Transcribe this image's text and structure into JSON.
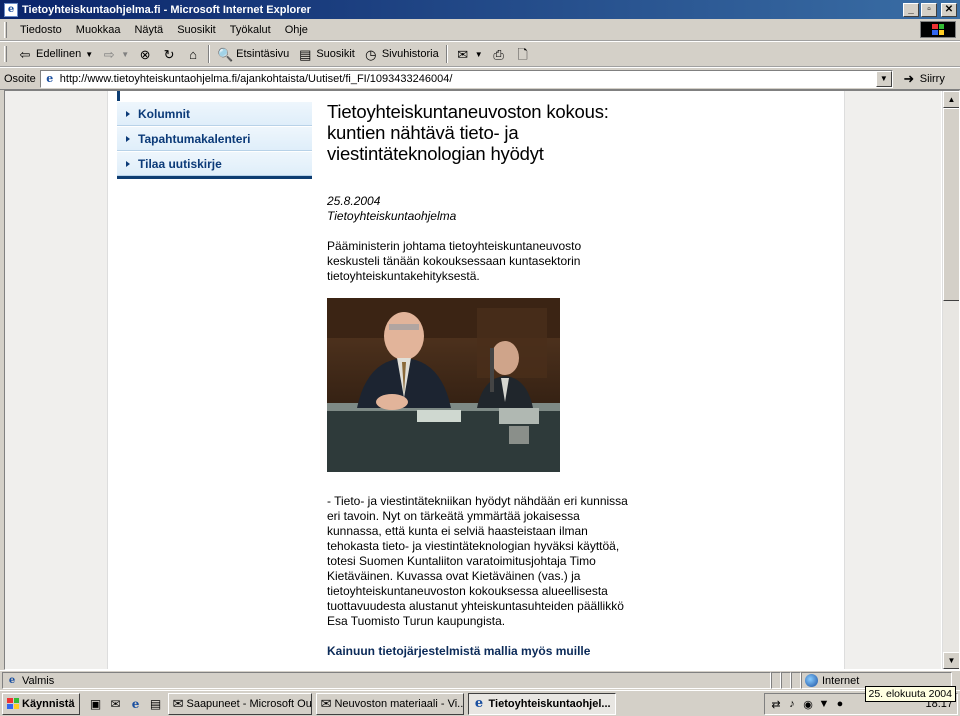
{
  "window": {
    "title": "Tietoyhteiskuntaohjelma.fi - Microsoft Internet Explorer",
    "controls": {
      "minimize": "_",
      "maximize": "▫",
      "close": "✕"
    }
  },
  "menu": {
    "items": [
      "Tiedosto",
      "Muokkaa",
      "Näytä",
      "Suosikit",
      "Työkalut",
      "Ohje"
    ]
  },
  "toolbar": {
    "back_label": "Edellinen",
    "search_label": "Etsintäsivu",
    "favorites_label": "Suosikit",
    "history_label": "Sivuhistoria"
  },
  "address": {
    "label": "Osoite",
    "url": "http://www.tietoyhteiskuntaohjelma.fi/ajankohtaista/Uutiset/fi_FI/1093433246004/",
    "go_label": "Siirry"
  },
  "sidebar_nav": {
    "items": [
      "Kolumnit",
      "Tapahtumakalenteri",
      "Tilaa uutiskirje"
    ]
  },
  "article": {
    "headline": "Tietoyhteiskuntaneuvoston kokous: kuntien nähtävä tieto- ja viestintäteknologian hyödyt",
    "date": "25.8.2004",
    "source": "Tietoyhteiskuntaohjelma",
    "lead": "Pääministerin johtama tietoyhteiskuntaneuvosto keskusteli tänään kokouksessaan kuntasektorin tietoyhteiskuntakehityksestä.",
    "caption": "- Tieto- ja viestintätekniikan hyödyt nähdään eri kunnissa eri tavoin. Nyt on tärkeätä ymmärtää jokaisessa kunnassa, että kunta ei selviä haasteistaan ilman tehokasta tieto- ja viestintäteknologian hyväksi käyttöä, totesi Suomen Kuntaliiton varatoimitusjohtaja Timo Kietäväinen. Kuvassa ovat Kietäväinen (vas.) ja tietoyhteiskuntaneuvoston kokouksessa alueellisesta tuottavuudesta alustanut yhteiskuntasuhteiden päällikkö Esa Tuomisto Turun kaupungista.",
    "subheading": "Kainuun tietojärjestelmistä mallia myös muille"
  },
  "status": {
    "text": "Valmis",
    "zone": "Internet"
  },
  "taskbar": {
    "start_label": "Käynnistä",
    "tasks": [
      {
        "label": "Saapuneet - Microsoft Ou...",
        "active": false
      },
      {
        "label": "Neuvoston materiaali - Vi...",
        "active": false
      },
      {
        "label": "Tietoyhteiskuntaohjel...",
        "active": true
      }
    ],
    "clock": "18:17",
    "tooltip": "25. elokuuta 2004"
  }
}
